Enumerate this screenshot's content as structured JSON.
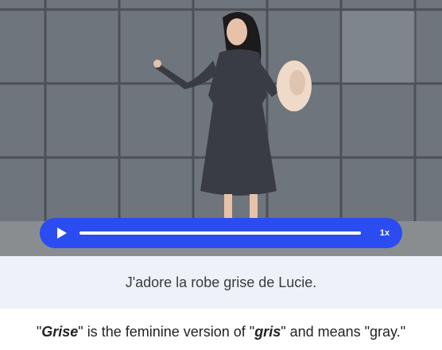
{
  "audio_player": {
    "play_icon": "play-icon",
    "progress_fraction": 1.0,
    "speed_label": "1x",
    "accent_color": "#2b4cf0"
  },
  "caption": {
    "text": "J'adore la robe grise de Lucie."
  },
  "note": {
    "q1": "\"",
    "term1": "Grise",
    "mid1": "\" is the feminine version of \"",
    "term2": "gris",
    "end": "\" and means \"gray.\""
  },
  "photo": {
    "icon": "photo-woman-gray-dress"
  }
}
